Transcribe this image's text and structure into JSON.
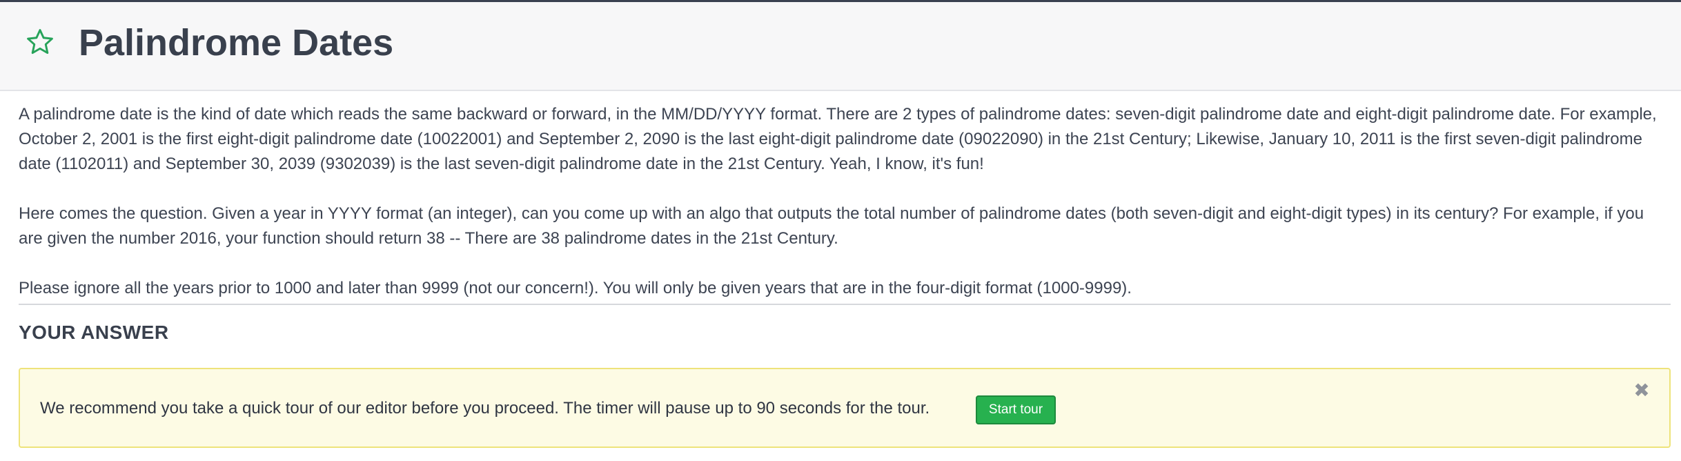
{
  "header": {
    "title": "Palindrome Dates",
    "icon": "star-outline-icon",
    "icon_color": "#27a35a"
  },
  "problem": {
    "paragraphs": [
      "A palindrome date is the kind of date which reads the same backward or forward, in the MM/DD/YYYY format. There are 2 types of palindrome dates: seven-digit palindrome date and eight-digit palindrome date. For example, October 2, 2001 is the first eight-digit palindrome date (10022001) and September 2, 2090 is the last eight-digit palindrome date (09022090) in the 21st Century; Likewise, January 10, 2011 is the first seven-digit palindrome date (1102011) and September 30, 2039 (9302039) is the last seven-digit palindrome date in the 21st Century. Yeah, I know, it's fun!",
      "Here comes the question. Given a year in YYYY format (an integer), can you come up with an algo that outputs the total number of palindrome dates (both seven-digit and eight-digit types) in its century? For example, if you are given the number 2016, your function should return 38 -- There are 38 palindrome dates in the 21st Century.",
      "Please ignore all the years prior to 1000 and later than 9999 (not our concern!). You will only be given years that are in the four-digit format (1000-9999)."
    ]
  },
  "answer_section": {
    "heading": "YOUR ANSWER"
  },
  "tour_banner": {
    "message": "We recommend you take a quick tour of our editor before you proceed. The timer will pause up to 90 seconds for the tour.",
    "start_label": "Start tour",
    "close_glyph": "✖",
    "background": "#fdfbe4",
    "button_color": "#27b14f"
  }
}
